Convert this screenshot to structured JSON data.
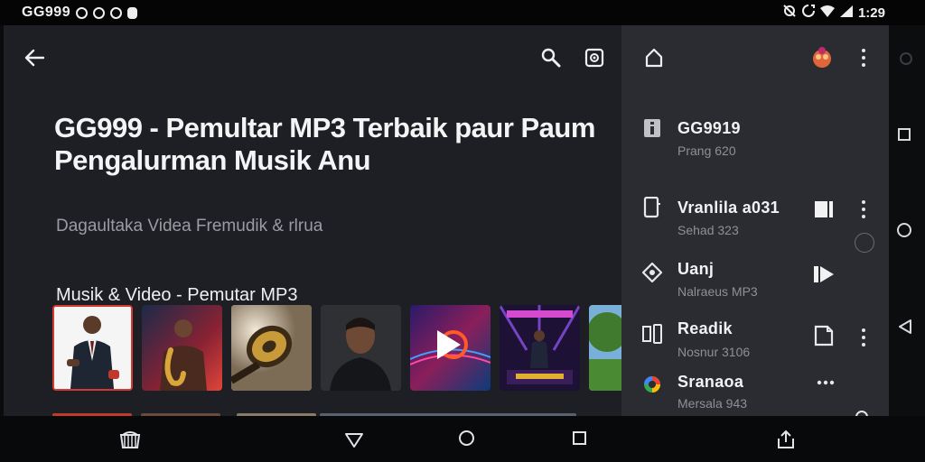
{
  "status_bar": {
    "brand": "GG999",
    "icons_left": [
      "google-icon",
      "google-icon",
      "chrome-icon",
      "notification-icon"
    ],
    "icons_right": [
      "mute-icon",
      "sync-icon",
      "wifi-icon",
      "signal-icon"
    ],
    "time": "1:29"
  },
  "header": {
    "icons": [
      "back-arrow-icon",
      "search-icon",
      "cast-icon"
    ]
  },
  "main": {
    "title": "GG999 - Pemultar MP3 Terbaik paur Paum Pengalurman Musik Anu",
    "subtitle": "Dagaultaka Videa Fremudik & rlrua",
    "section_title": "Musik & Video - Pemutar MP3",
    "thumbnails": [
      {
        "name": "man-in-suit-thumbnail"
      },
      {
        "name": "saxophone-player-thumbnail"
      },
      {
        "name": "gold-vinyl-thumbnail"
      },
      {
        "name": "portrait-thumbnail"
      },
      {
        "name": "play-logo-thumbnail"
      },
      {
        "name": "stage-performer-thumbnail"
      },
      {
        "name": "nature-thumbnail"
      }
    ]
  },
  "panel": {
    "header_icons": [
      "share-icon",
      "profile-icon",
      "more-icon"
    ],
    "items": [
      {
        "title": "GG9919",
        "subtitle": "Prang 620",
        "icon": "info-icon",
        "action": ""
      },
      {
        "title": "Vranlila a031",
        "subtitle": "Sehad 323",
        "icon": "phone-icon",
        "action": "pause-icon"
      },
      {
        "title": "Uanj",
        "subtitle": "Nalraeus MP3",
        "icon": "location-icon",
        "action": "play-next-icon"
      },
      {
        "title": "Readik",
        "subtitle": "Nosnur 3106",
        "icon": "queue-icon",
        "action": "bookmark-icon"
      },
      {
        "title": "Sranaoa",
        "subtitle": "Mersala 943",
        "icon": "color-wheel-icon",
        "action": "search-icon"
      }
    ]
  },
  "nav_bar": {
    "icons": [
      "store-icon",
      "back-icon",
      "home-icon",
      "recents-icon",
      "share-icon"
    ]
  },
  "colors": {
    "background": "#1d1f24",
    "panel": "#2a2c31",
    "accent_red": "#d33a32",
    "text_primary": "#f2f2f4",
    "text_secondary": "#8e9096"
  }
}
